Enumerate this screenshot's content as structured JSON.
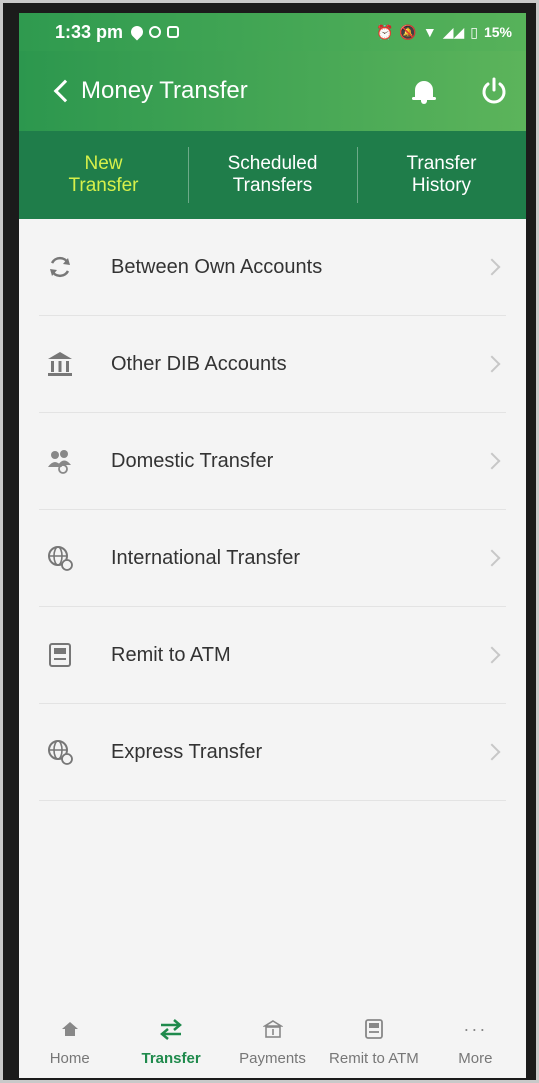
{
  "status_bar": {
    "time": "1:33 pm",
    "battery": "15%"
  },
  "header": {
    "title": "Money Transfer"
  },
  "tabs": [
    {
      "line1": "New",
      "line2": "Transfer"
    },
    {
      "line1": "Scheduled",
      "line2": "Transfers"
    },
    {
      "line1": "Transfer",
      "line2": "History"
    }
  ],
  "list": [
    {
      "label": "Between Own Accounts",
      "icon": "refresh-icon"
    },
    {
      "label": "Other DIB Accounts",
      "icon": "bank-icon"
    },
    {
      "label": "Domestic Transfer",
      "icon": "people-transfer-icon"
    },
    {
      "label": "International Transfer",
      "icon": "globe-icon"
    },
    {
      "label": "Remit to ATM",
      "icon": "atm-icon"
    },
    {
      "label": "Express Transfer",
      "icon": "globe-icon"
    }
  ],
  "bottom_nav": [
    {
      "label": "Home",
      "icon": "home-icon"
    },
    {
      "label": "Transfer",
      "icon": "transfer-icon"
    },
    {
      "label": "Payments",
      "icon": "payments-icon"
    },
    {
      "label": "Remit to ATM",
      "icon": "atm-icon"
    },
    {
      "label": "More",
      "icon": "more-icon"
    }
  ],
  "colors": {
    "brand_green": "#2c974e",
    "tab_bar": "#1f7d4a",
    "active_tab": "#d6f04a",
    "active_nav": "#1f8a4c"
  }
}
